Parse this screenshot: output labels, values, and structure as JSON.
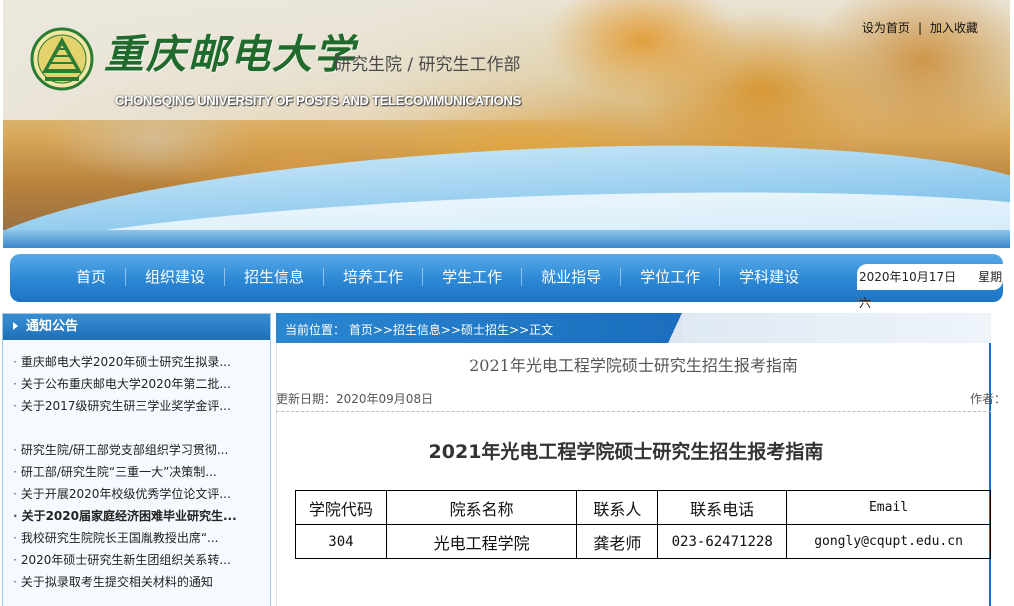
{
  "header": {
    "school_name_cn": "重庆邮电大学",
    "dept_name": "研究生院 / 研究生工作部",
    "school_name_en": "CHONGQING UNIVERSITY OF POSTS AND TELECOMMUNICATIONS",
    "links": {
      "set_home": "设为首页",
      "separator": "|",
      "add_favorite": "加入收藏"
    }
  },
  "nav": {
    "items": [
      "首页",
      "组织建设",
      "招生信息",
      "培养工作",
      "学生工作",
      "就业指导",
      "学位工作",
      "学科建设"
    ],
    "date": "2020年10月17日",
    "weekday": "星期六"
  },
  "notices": {
    "title": "通知公告",
    "items": [
      "重庆邮电大学2020年硕士研究生拟录...",
      "关于公布重庆邮电大学2020年第二批...",
      "关于2017级研究生研三学业奖学金评...",
      "研究生院/研工部党支部组织学习贯彻...",
      "研工部/研究生院“三重一大”决策制...",
      "关于开展2020年校级优秀学位论文评...",
      "关于2020届家庭经济困难毕业研究生...",
      "我校研究生院院长王国胤教授出席“...",
      "2020年硕士研究生新生团组织关系转...",
      "关于拟录取考生提交相关材料的通知"
    ]
  },
  "breadcrumb": {
    "text": "当前位置： 首页>>招生信息>>硕士招生>>正文"
  },
  "article": {
    "title": "2021年光电工程学院硕士研究生招生报考指南",
    "update_date": "更新日期：2020年09月08日",
    "author_label": "作者：",
    "content_title": "2021年光电工程学院硕士研究生招生报考指南",
    "table": {
      "headers": [
        "学院代码",
        "院系名称",
        "联系人",
        "联系电话",
        "Email"
      ],
      "rows": [
        [
          "304",
          "光电工程学院",
          "龚老师",
          "023-62471228",
          "gongly@cqupt.edu.cn"
        ]
      ]
    }
  },
  "colors": {
    "nav_blue": "#2f8ad6",
    "logo_green": "#1f6a2c",
    "crumb_blue": "#1b6fbe"
  }
}
